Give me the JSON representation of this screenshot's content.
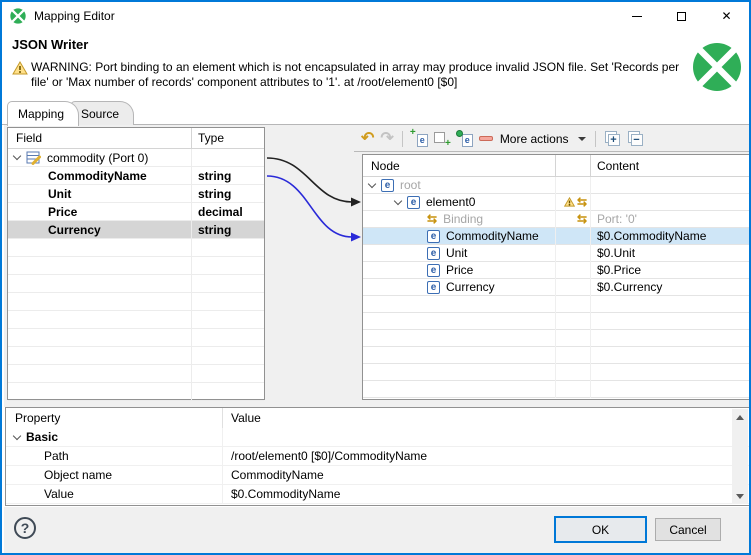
{
  "window": {
    "title": "Mapping Editor"
  },
  "header": {
    "component_title": "JSON Writer",
    "warning_text": "WARNING: Port binding to an element which is not encapsulated in array may produce invalid JSON file. Set 'Records per file' or 'Max number of records' component attributes to '1'. at /root/element0 [$0]"
  },
  "tabs": {
    "mapping": "Mapping",
    "source": "Source"
  },
  "field_table": {
    "col_field": "Field",
    "col_type": "Type",
    "root_label": "commodity (Port 0)",
    "rows": [
      {
        "field": "CommodityName",
        "type": "string"
      },
      {
        "field": "Unit",
        "type": "string"
      },
      {
        "field": "Price",
        "type": "decimal"
      },
      {
        "field": "Currency",
        "type": "string"
      }
    ],
    "selected_field": "Currency"
  },
  "toolbar": {
    "more_actions_label": "More actions"
  },
  "node_table": {
    "col_node": "Node",
    "col_content": "Content",
    "rows": [
      {
        "label": "root",
        "content": ""
      },
      {
        "label": "element0",
        "content": ""
      },
      {
        "label": "Binding",
        "content": "Port: '0'"
      },
      {
        "label": "CommodityName",
        "content": "$0.CommodityName"
      },
      {
        "label": "Unit",
        "content": "$0.Unit"
      },
      {
        "label": "Price",
        "content": "$0.Price"
      },
      {
        "label": "Currency",
        "content": "$0.Currency"
      }
    ],
    "selected_node": "CommodityName"
  },
  "property_table": {
    "col_property": "Property",
    "col_value": "Value",
    "group_label": "Basic",
    "rows": [
      {
        "property": "Path",
        "value": "/root/element0 [$0]/CommodityName"
      },
      {
        "property": "Object name",
        "value": "CommodityName"
      },
      {
        "property": "Value",
        "value": "$0.CommodityName"
      }
    ]
  },
  "footer": {
    "ok_label": "OK",
    "cancel_label": "Cancel",
    "help_glyph": "?"
  },
  "icons": {
    "undo": "↶",
    "redo": "↷",
    "binding": "⇆",
    "element": "e",
    "expand": "+",
    "collapse": "−",
    "close": "✕",
    "plus": "+"
  },
  "colors": {
    "accent_blue": "#0079d8",
    "clover_green": "#2fae57",
    "selection_blue": "#cfe6f7",
    "selection_gray": "#d5d5d5",
    "binding_gold": "#c8930f",
    "warning_yellow": "#ffd24a",
    "arrow_black": "#222222",
    "arrow_blue": "#2a2ad8"
  }
}
